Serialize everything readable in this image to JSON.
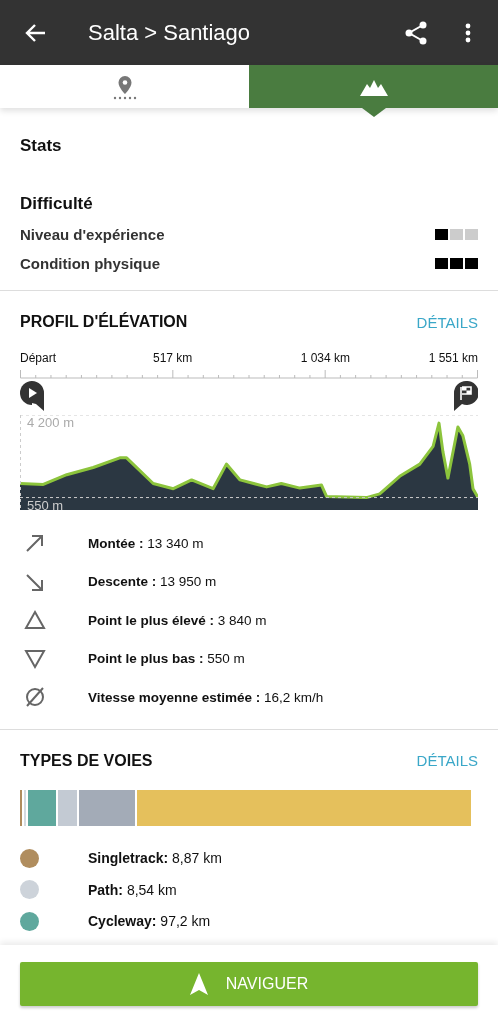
{
  "app_bar": {
    "title": "Salta > Santiago"
  },
  "tabs": [
    {
      "kind": "route",
      "selected": false
    },
    {
      "kind": "elevation",
      "selected": true
    }
  ],
  "stats": {
    "title": "Stats"
  },
  "difficulty": {
    "title": "Difficulté",
    "rows": [
      {
        "label": "Niveau d'expérience",
        "stars": 1
      },
      {
        "label": "Condition physique",
        "stars": 3
      }
    ]
  },
  "elevation_profile": {
    "title": "PROFIL D'ÉLÉVATION",
    "details": "DÉTAILS",
    "chart_data": {
      "type": "area",
      "x": [
        0,
        79,
        158,
        248,
        338,
        361,
        451,
        519,
        581,
        654,
        699,
        745,
        835,
        885,
        948,
        1021,
        1038,
        1173,
        1218,
        1286,
        1354,
        1399,
        1419,
        1432,
        1449,
        1483,
        1500,
        1523,
        1534,
        1551
      ],
      "series": [
        {
          "color": "#8cc43c",
          "values": [
            1170,
            1130,
            1560,
            1880,
            2310,
            2310,
            1170,
            940,
            1330,
            940,
            2030,
            1330,
            1020,
            1170,
            970,
            1100,
            600,
            550,
            710,
            1490,
            2030,
            2810,
            3840,
            2580,
            1410,
            3670,
            3280,
            2030,
            940,
            550
          ]
        }
      ],
      "xlim": [
        0,
        1551
      ],
      "ylim": [
        0,
        4200
      ],
      "xticks": [
        {
          "value": 0,
          "label": "Départ"
        },
        {
          "value": 517,
          "label": "517 km"
        },
        {
          "value": 1034,
          "label": "1 034 km"
        },
        {
          "value": 1551,
          "label": "1 551 km"
        }
      ],
      "yticks": [
        {
          "value": 4200,
          "label": "4 200 m"
        },
        {
          "value": 550,
          "label": "550 m"
        }
      ]
    },
    "stats": [
      {
        "kind": "ascent",
        "label": "Montée :",
        "value": "13 340 m"
      },
      {
        "kind": "descent",
        "label": "Descente :",
        "value": "13 950 m"
      },
      {
        "kind": "highest",
        "label": "Point le plus élevé :",
        "value": "3 840 m"
      },
      {
        "kind": "lowest",
        "label": "Point le plus bas :",
        "value": "550 m"
      },
      {
        "kind": "speed",
        "label": "Vitesse moyenne estimée :",
        "value": "16,2 km/h"
      }
    ]
  },
  "way_types": {
    "title": "TYPES DE VOIES",
    "details": "DÉTAILS",
    "segments": [
      {
        "color": "#b08d5e"
      },
      {
        "color": "#d4dae0"
      },
      {
        "color": "#5fa89d"
      },
      {
        "color": "#c3cad3"
      },
      {
        "color": "#a3abb7"
      },
      {
        "color": "#e5c05c"
      }
    ],
    "legend": [
      {
        "label": "Singletrack:",
        "value": "8,87 km",
        "color": "#b08d5e"
      },
      {
        "label": "Path:",
        "value": "8,54 km",
        "color": "#cdd3da"
      },
      {
        "label": "Cycleway:",
        "value": "97,2 km",
        "color": "#5fa89d"
      }
    ]
  },
  "navigate_button": {
    "label": "NAVIGUER"
  }
}
